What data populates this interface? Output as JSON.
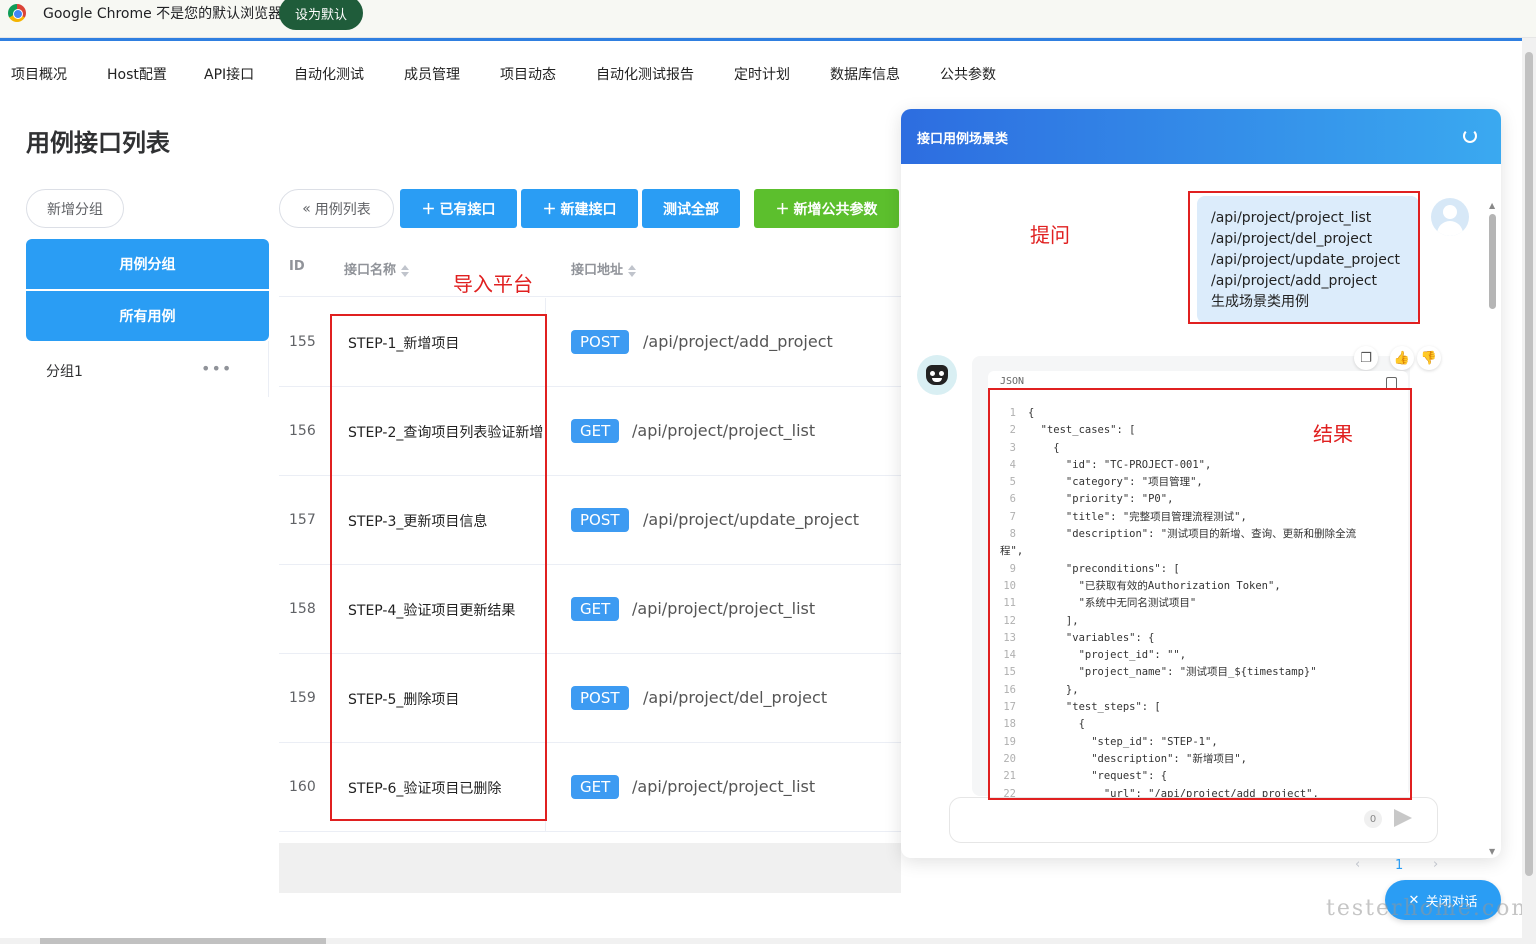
{
  "infobar": {
    "message": "Google Chrome 不是您的默认浏览器",
    "set_default": "设为默认"
  },
  "nav": {
    "items": [
      "项目概况",
      "Host配置",
      "API接口",
      "自动化测试",
      "成员管理",
      "项目动态",
      "自动化测试报告",
      "定时计划",
      "数据库信息",
      "公共参数"
    ]
  },
  "page": {
    "title": "用例接口列表"
  },
  "sidebar": {
    "add_group": "新增分组",
    "case_group": "用例分组",
    "all_cases": "所有用例",
    "group1": "分组1",
    "more": "•••"
  },
  "toolbar": {
    "case_list": "用例列表",
    "existing_api": "已有接口",
    "new_api": "新建接口",
    "test_all": "测试全部",
    "add_public_param": "新增公共参数"
  },
  "table": {
    "headers": {
      "id": "ID",
      "name": "接口名称",
      "address": "接口地址"
    },
    "rows": [
      {
        "id": "155",
        "name": "STEP-1_新增项目",
        "method": "POST",
        "url": "/api/project/add_project"
      },
      {
        "id": "156",
        "name": "STEP-2_查询项目列表验证新增",
        "method": "GET",
        "url": "/api/project/project_list"
      },
      {
        "id": "157",
        "name": "STEP-3_更新项目信息",
        "method": "POST",
        "url": "/api/project/update_project"
      },
      {
        "id": "158",
        "name": "STEP-4_验证项目更新结果",
        "method": "GET",
        "url": "/api/project/project_list"
      },
      {
        "id": "159",
        "name": "STEP-5_删除项目",
        "method": "POST",
        "url": "/api/project/del_project"
      },
      {
        "id": "160",
        "name": "STEP-6_验证项目已删除",
        "method": "GET",
        "url": "/api/project/project_list"
      }
    ]
  },
  "annotations": {
    "import_platform": "导入平台",
    "question": "提问",
    "result": "结果"
  },
  "chat": {
    "title": "接口用例场景类",
    "user_message": [
      "/api/project/project_list",
      "/api/project/del_project",
      "/api/project/update_project",
      "/api/project/add_project",
      "生成场景类用例"
    ],
    "code_lang": "JSON",
    "code_lines": [
      {
        "n": "1",
        "text": "{"
      },
      {
        "n": "2",
        "text": "  \"test_cases\": ["
      },
      {
        "n": "3",
        "text": "    {"
      },
      {
        "n": "4",
        "text": "      \"id\": \"TC-PROJECT-001\","
      },
      {
        "n": "5",
        "text": "      \"category\": \"项目管理\","
      },
      {
        "n": "6",
        "text": "      \"priority\": \"P0\","
      },
      {
        "n": "7",
        "text": "      \"title\": \"完整项目管理流程测试\","
      },
      {
        "n": "8",
        "text": "      \"description\": \"测试项目的新增、查询、更新和删除全流"
      },
      {
        "n": "",
        "text": "程\","
      },
      {
        "n": "9",
        "text": "      \"preconditions\": ["
      },
      {
        "n": "10",
        "text": "        \"已获取有效的Authorization Token\","
      },
      {
        "n": "11",
        "text": "        \"系统中无同名测试项目\""
      },
      {
        "n": "12",
        "text": "      ],"
      },
      {
        "n": "13",
        "text": "      \"variables\": {"
      },
      {
        "n": "14",
        "text": "        \"project_id\": \"\","
      },
      {
        "n": "15",
        "text": "        \"project_name\": \"测试项目_${timestamp}\""
      },
      {
        "n": "16",
        "text": "      },"
      },
      {
        "n": "17",
        "text": "      \"test_steps\": ["
      },
      {
        "n": "18",
        "text": "        {"
      },
      {
        "n": "19",
        "text": "          \"step_id\": \"STEP-1\","
      },
      {
        "n": "20",
        "text": "          \"description\": \"新增项目\","
      },
      {
        "n": "21",
        "text": "          \"request\": {"
      },
      {
        "n": "22",
        "text": "            \"url\": \"/api/project/add_project\","
      }
    ],
    "char_count": "0",
    "pager_page": "1",
    "close_button": "关闭对话"
  },
  "watermark": "testerhome.com",
  "colors": {
    "primary": "#2a9df4",
    "success": "#5cbf2d",
    "annotation": "#e02020",
    "method_tag": "#3d9bf2"
  }
}
